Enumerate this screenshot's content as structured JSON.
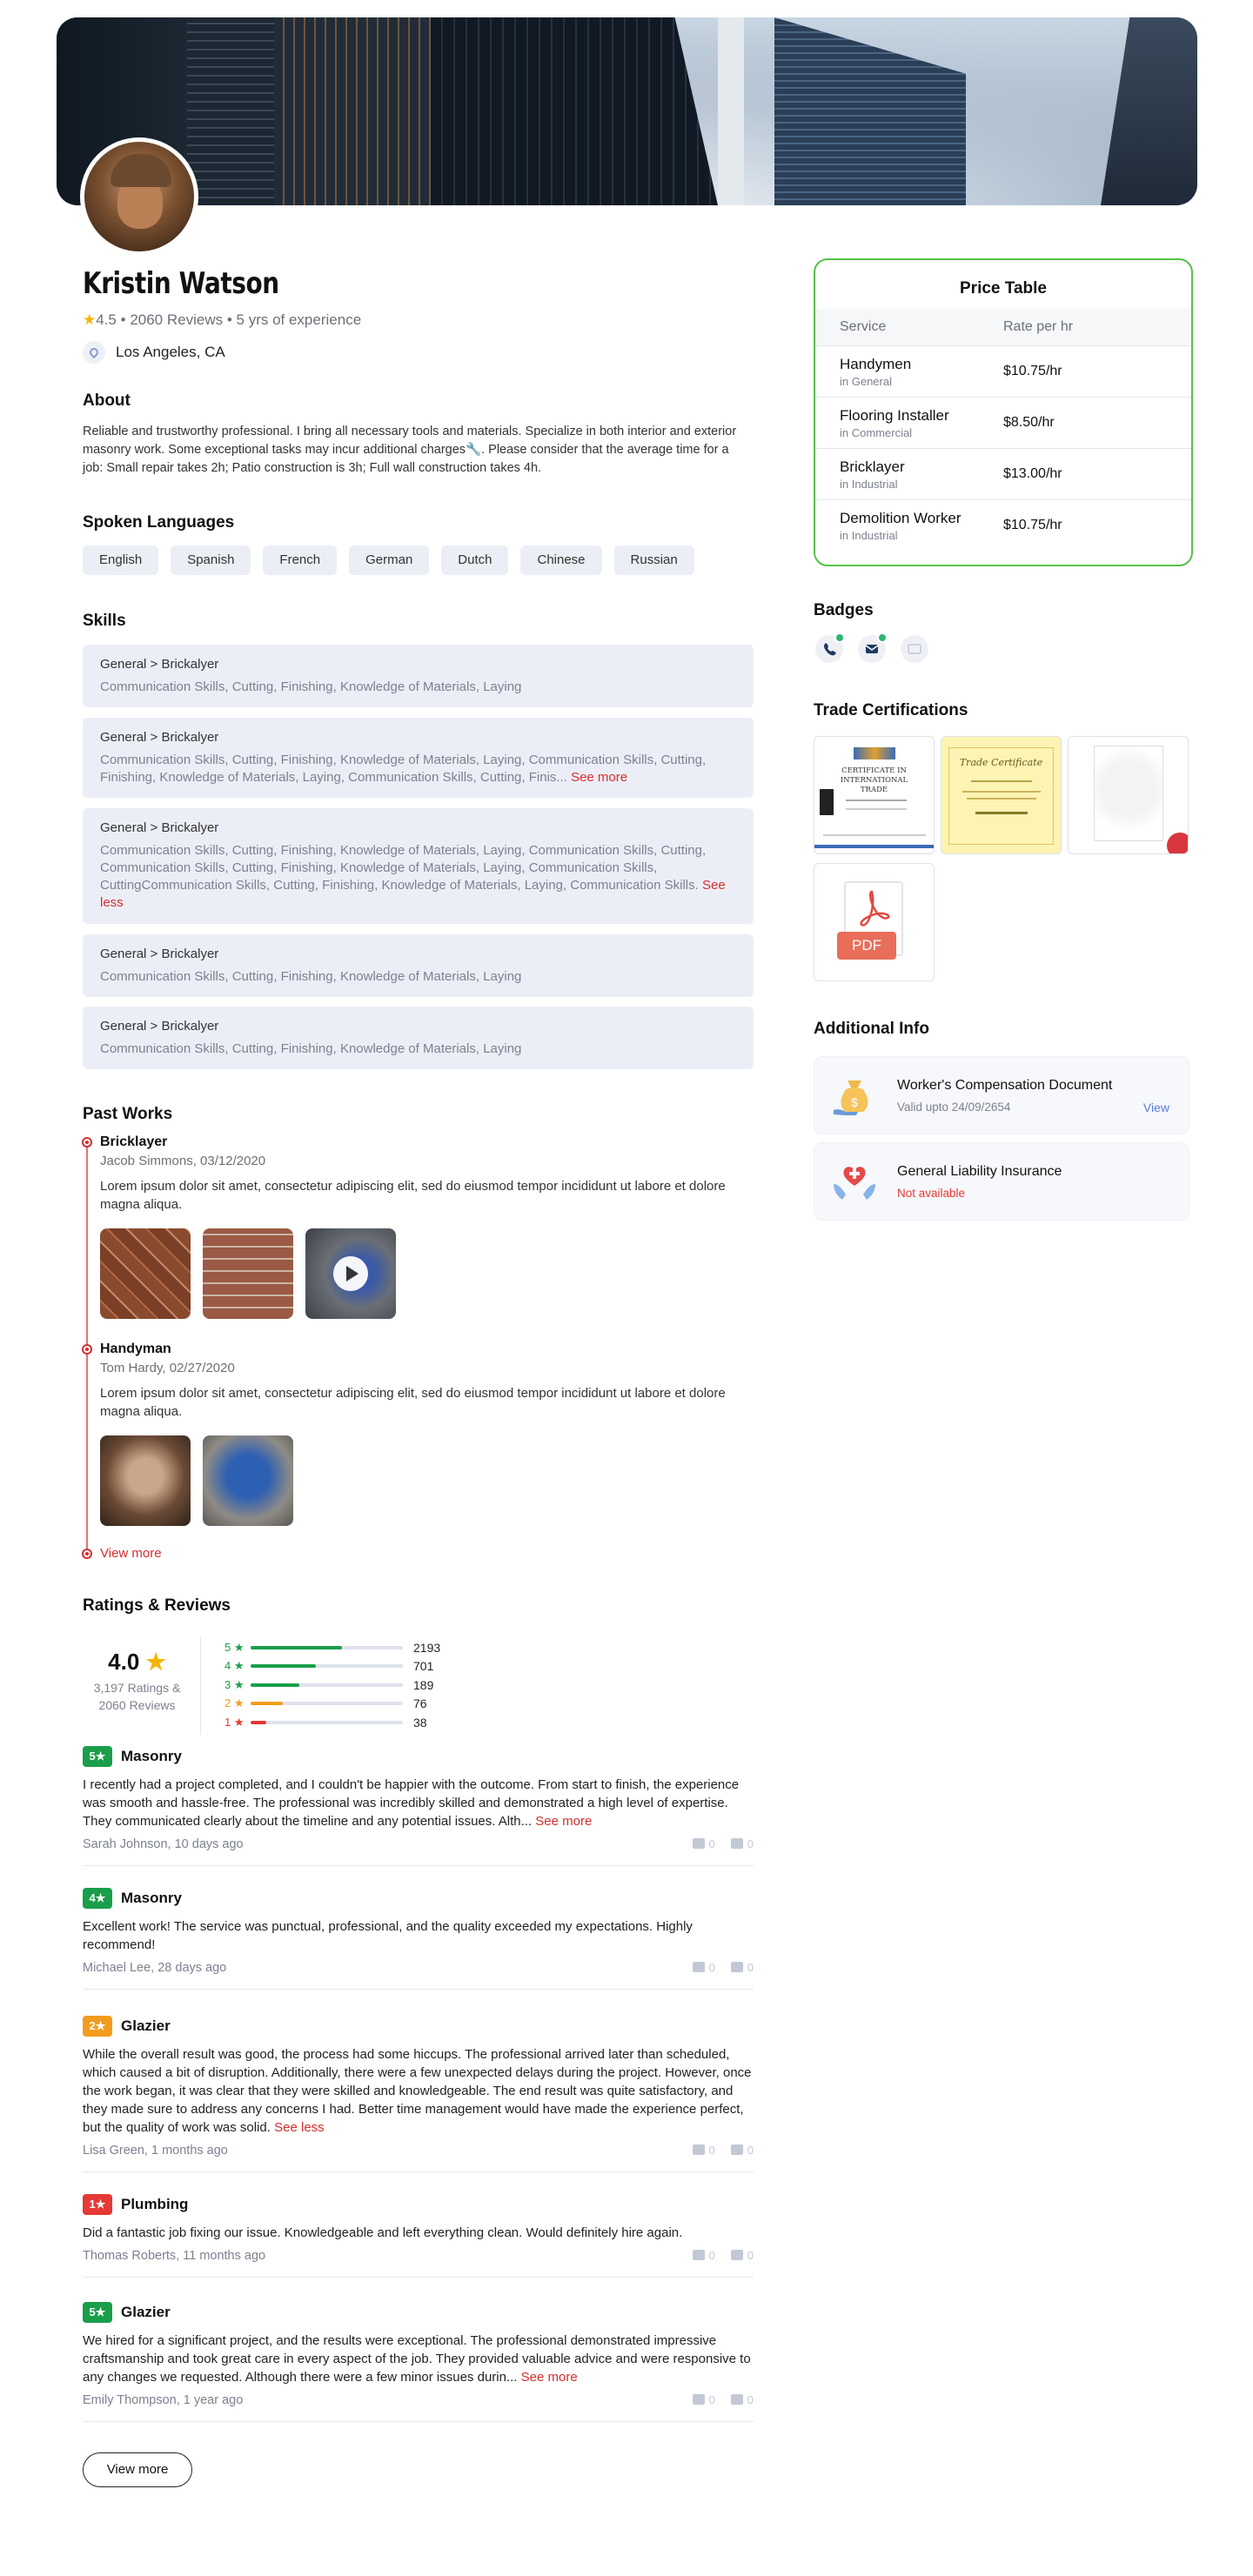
{
  "profile": {
    "name": "Kristin Watson",
    "rating": "4.5",
    "reviews": "2060 Reviews",
    "experience": "5 yrs of experience",
    "location": "Los Angeles, CA"
  },
  "about": {
    "title": "About",
    "text": "Reliable and trustworthy professional. I bring all necessary tools and materials. Specialize in both interior and exterior masonry work. Some exceptional tasks may incur additional charges🔧. Please consider that the average time for a job: Small repair takes 2h; Patio construction is 3h; Full wall construction takes 4h."
  },
  "languages": {
    "title": "Spoken Languages",
    "items": [
      "English",
      "Spanish",
      "French",
      "German",
      "Dutch",
      "Chinese",
      "Russian"
    ]
  },
  "skills": {
    "title": "Skills",
    "items": [
      {
        "title": "General > Brickalyer",
        "desc": "Communication Skills, Cutting, Finishing, Knowledge of Materials, Laying",
        "link": ""
      },
      {
        "title": "General > Brickalyer",
        "desc": "Communication Skills, Cutting, Finishing, Knowledge of Materials, Laying, Communication Skills, Cutting, Finishing, Knowledge of Materials, Laying, Communication Skills, Cutting, Finis...",
        "link": "See more"
      },
      {
        "title": "General > Brickalyer",
        "desc": "Communication Skills, Cutting, Finishing, Knowledge of Materials, Laying, Communication Skills, Cutting, Communication Skills, Cutting, Finishing, Knowledge of Materials, Laying, Communication Skills, CuttingCommunication Skills, Cutting, Finishing, Knowledge of Materials, Laying, Communication Skills.",
        "link": "See less"
      },
      {
        "title": "General > Brickalyer",
        "desc": "Communication Skills, Cutting, Finishing, Knowledge of Materials, Laying",
        "link": ""
      },
      {
        "title": "General > Brickalyer",
        "desc": "Communication Skills, Cutting, Finishing, Knowledge of Materials, Laying",
        "link": ""
      }
    ]
  },
  "past_works": {
    "title": "Past Works",
    "items": [
      {
        "title": "Bricklayer",
        "sub": "Jacob Simmons, 03/12/2020",
        "text": "Lorem ipsum dolor sit amet, consectetur adipiscing elit, sed do eiusmod tempor incididunt ut labore et dolore magna aliqua."
      },
      {
        "title": "Handyman",
        "sub": "Tom Hardy, 02/27/2020",
        "text": "Lorem ipsum dolor sit amet, consectetur adipiscing elit, sed do eiusmod tempor incididunt ut labore et dolore magna aliqua."
      }
    ],
    "view_more": "View more"
  },
  "ratings": {
    "title": "Ratings & Reviews",
    "average": "4.0",
    "summary_line1": "3,197 Ratings &",
    "summary_line2": "2060 Reviews",
    "breakdown": [
      {
        "label": "5 ★",
        "count": "2193",
        "fraction": 0.6,
        "color": "#1a9e4b"
      },
      {
        "label": "4 ★",
        "count": "701",
        "fraction": 0.43,
        "color": "#1a9e4b"
      },
      {
        "label": "3 ★",
        "count": "189",
        "fraction": 0.32,
        "color": "#1a9e4b"
      },
      {
        "label": "2 ★",
        "count": "76",
        "fraction": 0.21,
        "color": "#f29c1f"
      },
      {
        "label": "1 ★",
        "count": "38",
        "fraction": 0.1,
        "color": "#e53935"
      }
    ]
  },
  "reviews": [
    {
      "badge": "5★",
      "color": "#1a9e4b",
      "category": "Masonry",
      "text": "I recently had a project completed, and I couldn't be happier with the outcome. From start to finish, the experience was smooth and hassle-free. The professional was incredibly skilled and demonstrated a high level of expertise. They communicated clearly about the timeline and any potential issues. Alth...",
      "link": "See more",
      "by": "Sarah Johnson, 10 days ago",
      "up": "0",
      "down": "0"
    },
    {
      "badge": "4★",
      "color": "#1a9e4b",
      "category": "Masonry",
      "text": "Excellent work! The service was punctual, professional, and the quality exceeded my expectations. Highly recommend!",
      "link": "",
      "by": "Michael Lee, 28 days ago",
      "up": "0",
      "down": "0"
    },
    {
      "badge": "2★",
      "color": "#f29c1f",
      "category": "Glazier",
      "text": "While the overall result was good, the process had some hiccups. The professional arrived later than scheduled, which caused a bit of disruption. Additionally, there were a few unexpected delays during the project. However, once the work began, it was clear that they were skilled and knowledgeable. The end result was quite satisfactory, and they made sure to address any concerns I had. Better time management would have made the experience perfect, but the quality of work was solid.",
      "link": "See less",
      "by": "Lisa Green, 1 months ago",
      "up": "0",
      "down": "0"
    },
    {
      "badge": "1★",
      "color": "#e53935",
      "category": "Plumbing",
      "text": "Did a fantastic job fixing our issue. Knowledgeable and left everything clean. Would definitely hire again.",
      "link": "",
      "by": "Thomas Roberts, 11 months ago",
      "up": "0",
      "down": "0"
    },
    {
      "badge": "5★",
      "color": "#1a9e4b",
      "category": "Glazier",
      "text": "We hired for a significant project, and the results were exceptional. The professional demonstrated impressive craftsmanship and took great care in every aspect of the job. They provided valuable advice and were responsive to any changes we requested. Although there were a few minor issues durin...",
      "link": "See more",
      "by": "Emily Thompson, 1 year ago",
      "up": "0",
      "down": "0"
    }
  ],
  "view_more_button": "View more",
  "price_table": {
    "title": "Price Table",
    "col_service": "Service",
    "col_rate": "Rate per hr",
    "rows": [
      {
        "service": "Handymen",
        "category": "in General",
        "rate": "$10.75/hr"
      },
      {
        "service": "Flooring Installer",
        "category": "in Commercial",
        "rate": "$8.50/hr"
      },
      {
        "service": "Bricklayer",
        "category": "in Industrial",
        "rate": "$13.00/hr"
      },
      {
        "service": "Demolition Worker",
        "category": "in Industrial",
        "rate": "$10.75/hr"
      }
    ]
  },
  "badges": {
    "title": "Badges",
    "icons": [
      "phone-icon",
      "email-icon",
      "id-card-icon"
    ]
  },
  "certifications": {
    "title": "Trade Certifications",
    "cert1_title": "CERTIFICATE IN INTERNATIONAL TRADE",
    "cert2_title": "Trade Certificate",
    "pdf_label": "PDF"
  },
  "additional_info": {
    "title": "Additional Info",
    "items": [
      {
        "title": "Worker's Compensation Document",
        "status": "Valid upto 24/09/2654",
        "link": "View"
      },
      {
        "title": "General Liability Insurance",
        "status": "Not available",
        "link": ""
      }
    ]
  }
}
